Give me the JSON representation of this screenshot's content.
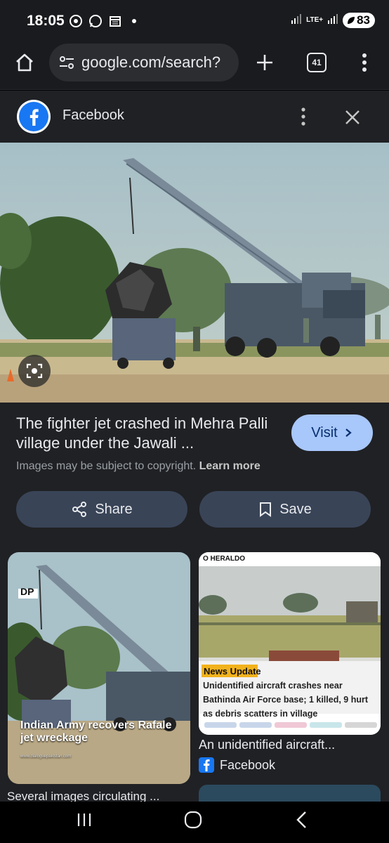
{
  "status_bar": {
    "time": "18:05",
    "network": "LTE+",
    "battery": "83",
    "icons": [
      "chrome-icon",
      "whatsapp-icon",
      "calendar-icon",
      "dot-icon",
      "vibrate-icon",
      "signal-icon",
      "signal-icon-2"
    ]
  },
  "toolbar": {
    "url": "google.com/search?",
    "tab_count": "41"
  },
  "source": {
    "name": "Facebook"
  },
  "result": {
    "title": "The fighter jet crashed in Mehra Palli village under the Jawali ...",
    "visit_label": "Visit",
    "copyright_text": "Images may be subject to copyright.",
    "learn_more": "Learn more",
    "share_label": "Share",
    "save_label": "Save"
  },
  "related": [
    {
      "overlay_line1": "Indian Army recovers Rafale",
      "overlay_line2": "jet wreckage",
      "watermark": "DP",
      "footer": "www.dialoguepakistan.com",
      "caption": "Several images circulating ..."
    },
    {
      "masthead": "O HERALDO",
      "badge": "News Update",
      "headline": "Unidentified aircraft crashes near Bathinda Air Force base; 1 killed, 9 hurt as debris scatters in village",
      "caption": "An unidentified aircraft...",
      "source": "Facebook"
    }
  ],
  "colors": {
    "accent": "#a8c7fa",
    "chip_bg": "#394457",
    "page_bg": "#202124",
    "facebook": "#1877f2"
  }
}
